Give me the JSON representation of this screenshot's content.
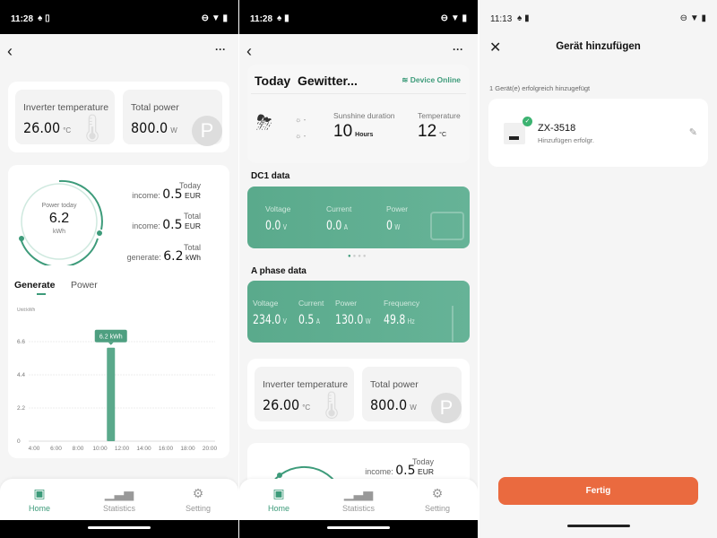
{
  "colors": {
    "accent": "#3d9b7a",
    "button": "#ea6a3f",
    "success": "#3cb371"
  },
  "panel1": {
    "status": {
      "time": "11:28"
    },
    "header": {
      "back_icon": "chevron-left",
      "more": "···"
    },
    "inverter": {
      "label": "Inverter temperature",
      "value": "26.00",
      "unit": "°C"
    },
    "total_power": {
      "label": "Total power",
      "value": "800.0",
      "unit": "W"
    },
    "ring": {
      "label": "Power today",
      "value": "6.2",
      "unit": "kWh"
    },
    "income": [
      {
        "label1": "Today",
        "label2": "income:",
        "value": "0.5",
        "unit": "EUR"
      },
      {
        "label1": "Total",
        "label2": "income:",
        "value": "0.5",
        "unit": "EUR"
      },
      {
        "label1": "Total",
        "label2": "generate:",
        "value": "6.2",
        "unit": "kWh"
      }
    ],
    "tabs": [
      {
        "label": "Generate",
        "active": true
      },
      {
        "label": "Power",
        "active": false
      }
    ],
    "nav": [
      {
        "label": "Home",
        "icon": "home",
        "active": true
      },
      {
        "label": "Statistics",
        "icon": "bar-chart"
      },
      {
        "label": "Setting",
        "icon": "gear"
      }
    ]
  },
  "chart_data": {
    "type": "bar",
    "ylabel": "Unit:kWh",
    "ylim": [
      0,
      6.6
    ],
    "yticks": [
      "0",
      "2.2",
      "4.4",
      "6.6"
    ],
    "xticks": [
      "4:00",
      "6:00",
      "8:00",
      "10:00",
      "12:00",
      "14:00",
      "16:00",
      "18:00",
      "20:00"
    ],
    "xlim": [
      4,
      20
    ],
    "bars": [
      {
        "x": 11,
        "value": 6.2
      }
    ],
    "tooltip": "6.2 kWh",
    "grid": true
  },
  "panel2": {
    "status": {
      "time": "11:28"
    },
    "more": "···",
    "title": "Today  Gewitter...",
    "online": "Device Online",
    "weather": {
      "icon": "thunderstorm",
      "sunrise": "-",
      "sunset": "-",
      "sun_label": "Sunshine duration",
      "sun_value": "10",
      "sun_unit": "Hours",
      "temp_label": "Temperature",
      "temp_value": "12",
      "temp_unit": "°C"
    },
    "dc1": {
      "title": "DC1 data",
      "items": [
        {
          "label": "Voltage",
          "value": "0.0",
          "unit": "V"
        },
        {
          "label": "Current",
          "value": "0.0",
          "unit": "A"
        },
        {
          "label": "Power",
          "value": "0",
          "unit": "W"
        }
      ]
    },
    "aphase": {
      "title": "A phase data",
      "items": [
        {
          "label": "Voltage",
          "value": "234.0",
          "unit": "V"
        },
        {
          "label": "Current",
          "value": "0.5",
          "unit": "A"
        },
        {
          "label": "Power",
          "value": "130.0",
          "unit": "W"
        },
        {
          "label": "Frequency",
          "value": "49.8",
          "unit": "Hz"
        }
      ]
    },
    "inverter": {
      "label": "Inverter temperature",
      "value": "26.00",
      "unit": "°C"
    },
    "total_power": {
      "label": "Total power",
      "value": "800.0",
      "unit": "W"
    },
    "income": {
      "label1": "Today",
      "label2": "income:",
      "value": "0.5",
      "unit": "EUR"
    }
  },
  "panel3": {
    "status": {
      "time": "11:13"
    },
    "title": "Gerät hinzufügen",
    "count_text": "1 Gerät(e) erfolgreich hinzugefügt",
    "device": {
      "name": "ZX-3518",
      "status": "Hinzufügen erfolgr."
    },
    "done": "Fertig"
  }
}
